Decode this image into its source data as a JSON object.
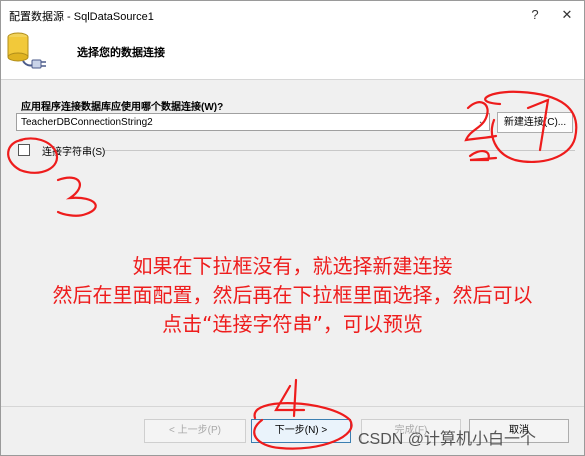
{
  "window": {
    "title": "配置数据源 - SqlDataSource1",
    "help_glyph": "?",
    "close_glyph": "✕"
  },
  "header": {
    "title": "选择您的数据连接",
    "icon": "database-plug-icon"
  },
  "connection": {
    "prompt": "应用程序连接数据库应使用哪个数据连接(W)?",
    "selected": "TeacherDBConnectionString2",
    "new_button": "新建连接(C)...",
    "show_string_label": "连接字符串(S)",
    "show_string_checked": false
  },
  "footer": {
    "prev": "< 上一步(P)",
    "next": "下一步(N) >",
    "finish": "完成(F)",
    "cancel": "取消"
  },
  "annotation": {
    "line1": "如果在下拉框没有，就选择新建连接",
    "line2": "然后在里面配置，然后再在下拉框里面选择，然后可以",
    "line3": "点击“连接字符串”，可以预览",
    "num1": "1",
    "num2": "2",
    "num3": "3",
    "num4": "4",
    "color": "#ee1c1c"
  },
  "watermark": "CSDN @计算机小白一个"
}
